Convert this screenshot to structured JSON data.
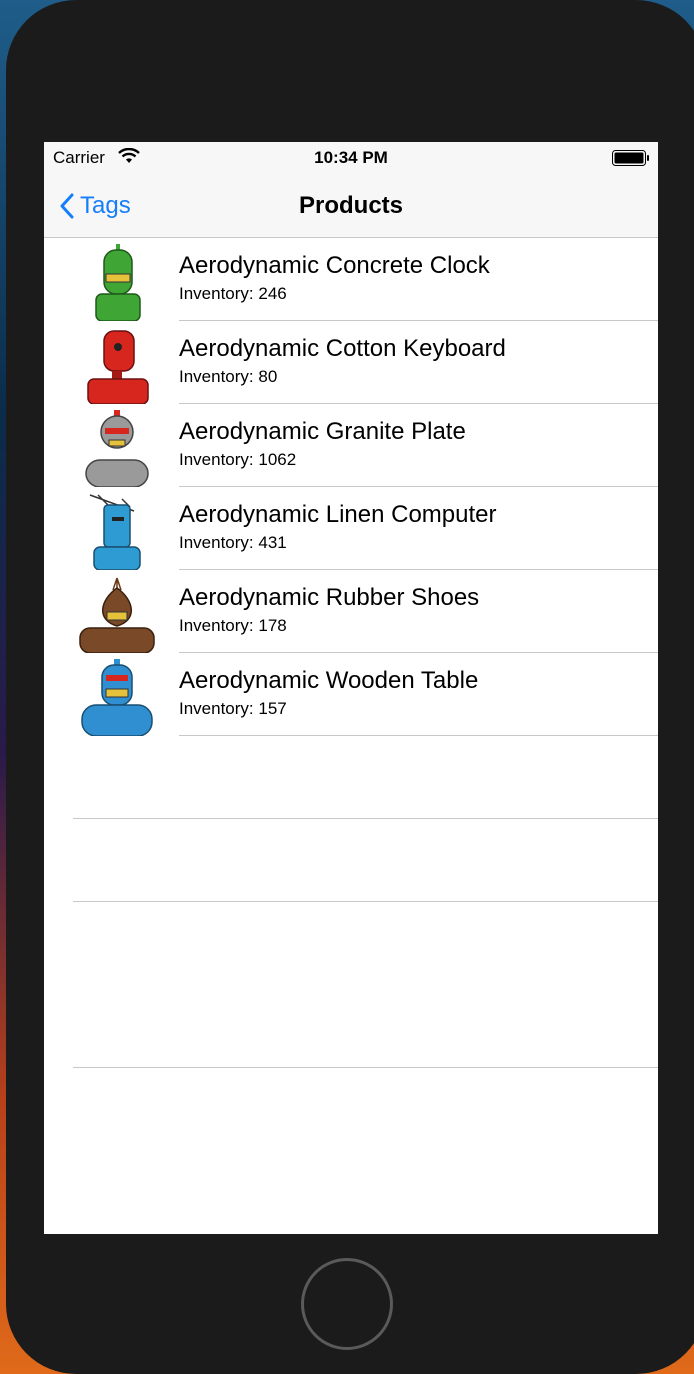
{
  "status_bar": {
    "carrier": "Carrier",
    "time": "10:34 PM"
  },
  "nav": {
    "back_label": "Tags",
    "title": "Products"
  },
  "products": [
    {
      "name": "Aerodynamic Concrete Clock",
      "inventory": "Inventory: 246",
      "avatar_color": "#3fa535",
      "icon": "green-robot-icon"
    },
    {
      "name": "Aerodynamic Cotton Keyboard",
      "inventory": "Inventory: 80",
      "avatar_color": "#d7261e",
      "icon": "red-robot-icon"
    },
    {
      "name": "Aerodynamic Granite Plate",
      "inventory": "Inventory: 1062",
      "avatar_color": "#9a9a9a",
      "icon": "gray-robot-icon"
    },
    {
      "name": "Aerodynamic Linen Computer",
      "inventory": "Inventory: 431",
      "avatar_color": "#2f9bd3",
      "icon": "blue-antenna-robot-icon"
    },
    {
      "name": "Aerodynamic Rubber Shoes",
      "inventory": "Inventory: 178",
      "avatar_color": "#7a4a28",
      "icon": "brown-robot-icon"
    },
    {
      "name": "Aerodynamic Wooden Table",
      "inventory": "Inventory: 157",
      "avatar_color": "#2f8fd0",
      "icon": "blue-robot-icon"
    }
  ],
  "colors": {
    "accent": "#147efb",
    "separator": "#c8c7cc",
    "bar_background": "#f7f7f7"
  }
}
